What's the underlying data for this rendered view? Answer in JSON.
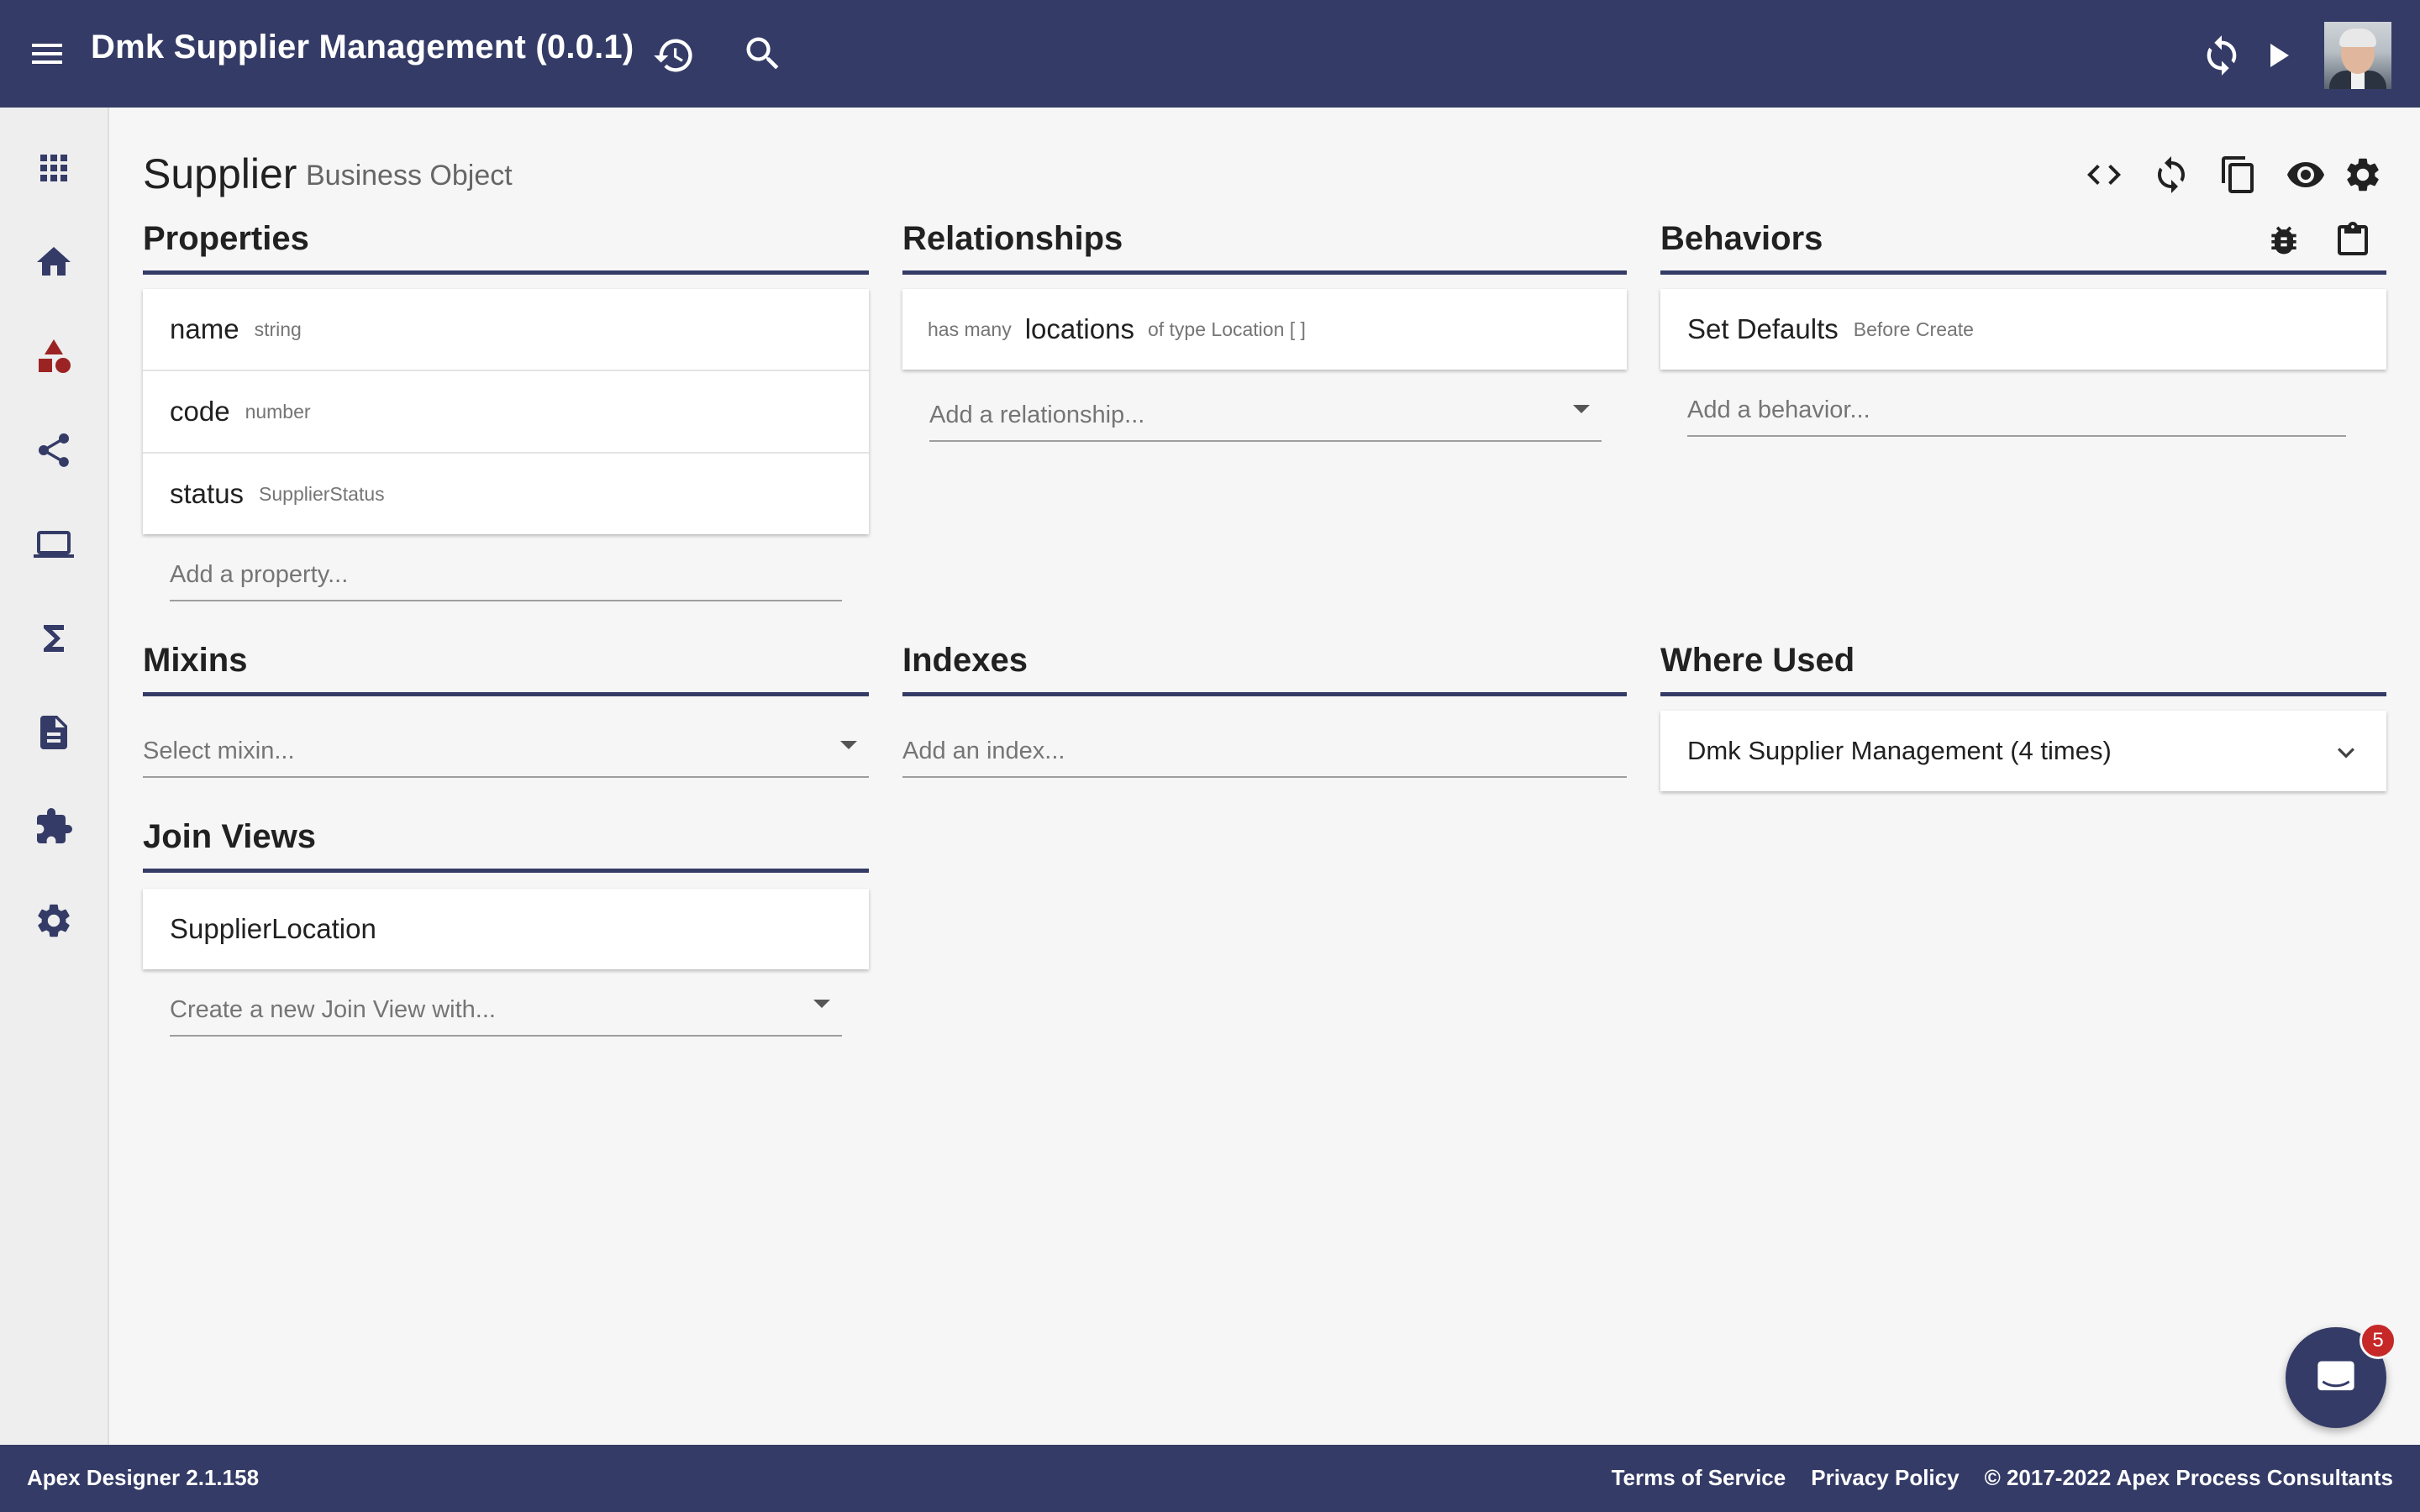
{
  "topbar": {
    "title": "Dmk Supplier Management (0.0.1)",
    "icons": [
      "menu-icon",
      "history-icon",
      "search-icon",
      "sync-icon",
      "play-icon",
      "avatar"
    ]
  },
  "sidenav": {
    "icons": [
      "apps-icon",
      "home-icon",
      "shapes-icon",
      "share-icon",
      "laptop-icon",
      "sigma-icon",
      "file-icon",
      "puzzle-icon",
      "gear-icon"
    ]
  },
  "page": {
    "title": "Supplier",
    "subtitle": "Business Object",
    "header_icons": [
      "code-icon",
      "sync-icon",
      "copy-icon",
      "eye-icon",
      "gear-icon"
    ]
  },
  "properties": {
    "heading": "Properties",
    "items": [
      {
        "name": "name",
        "type": "string"
      },
      {
        "name": "code",
        "type": "number"
      },
      {
        "name": "status",
        "type": "SupplierStatus"
      }
    ],
    "add_placeholder": "Add a property..."
  },
  "relationships": {
    "heading": "Relationships",
    "items": [
      {
        "cardinality": "has many",
        "name": "locations",
        "type": "of type Location [ ]"
      }
    ],
    "add_placeholder": "Add a relationship..."
  },
  "behaviors": {
    "heading": "Behaviors",
    "icons": [
      "bug-icon",
      "clipboard-icon"
    ],
    "items": [
      {
        "name": "Set Defaults",
        "when": "Before Create"
      }
    ],
    "add_placeholder": "Add a behavior..."
  },
  "mixins": {
    "heading": "Mixins",
    "select_placeholder": "Select mixin..."
  },
  "indexes": {
    "heading": "Indexes",
    "add_placeholder": "Add an index..."
  },
  "where_used": {
    "heading": "Where Used",
    "items": [
      {
        "label": "Dmk Supplier Management (4 times)"
      }
    ]
  },
  "join_views": {
    "heading": "Join Views",
    "items": [
      {
        "name": "SupplierLocation"
      }
    ],
    "create_placeholder": "Create a new Join View with..."
  },
  "footer": {
    "version": "Apex Designer 2.1.158",
    "links": [
      "Terms of Service",
      "Privacy Policy",
      "© 2017-2022 Apex Process Consultants"
    ]
  },
  "chat": {
    "badge_count": "5"
  },
  "colors": {
    "primary": "#343b66",
    "background": "#f6f6f6",
    "accent_icon": "#9c2323",
    "badge": "#c62828"
  }
}
